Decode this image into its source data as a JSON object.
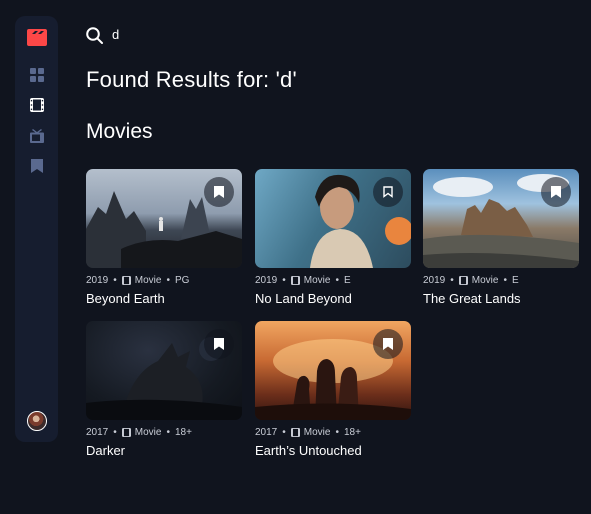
{
  "sidebar": {
    "logo": "film-clapper-icon",
    "items": [
      {
        "name": "home",
        "icon": "grid-icon"
      },
      {
        "name": "movies",
        "icon": "film-icon",
        "active": true
      },
      {
        "name": "tv-series",
        "icon": "tv-icon"
      },
      {
        "name": "bookmarks",
        "icon": "bookmark-icon"
      }
    ],
    "accent": "#fc4747",
    "inactive_color": "#5a698f"
  },
  "search": {
    "value": "d",
    "placeholder": "Search for movies or TV series"
  },
  "results_heading": "Found Results for: 'd'",
  "section_title": "Movies",
  "movies": [
    {
      "year": "2019",
      "category": "Movie",
      "rating": "PG",
      "title": "Beyond Earth"
    },
    {
      "year": "2019",
      "category": "Movie",
      "rating": "E",
      "title": "No Land Beyond"
    },
    {
      "year": "2019",
      "category": "Movie",
      "rating": "E",
      "title": "The Great Lands"
    },
    {
      "year": "2017",
      "category": "Movie",
      "rating": "18+",
      "title": "Darker"
    },
    {
      "year": "2017",
      "category": "Movie",
      "rating": "18+",
      "title": "Earth’s Untouched"
    }
  ],
  "separator": "•"
}
